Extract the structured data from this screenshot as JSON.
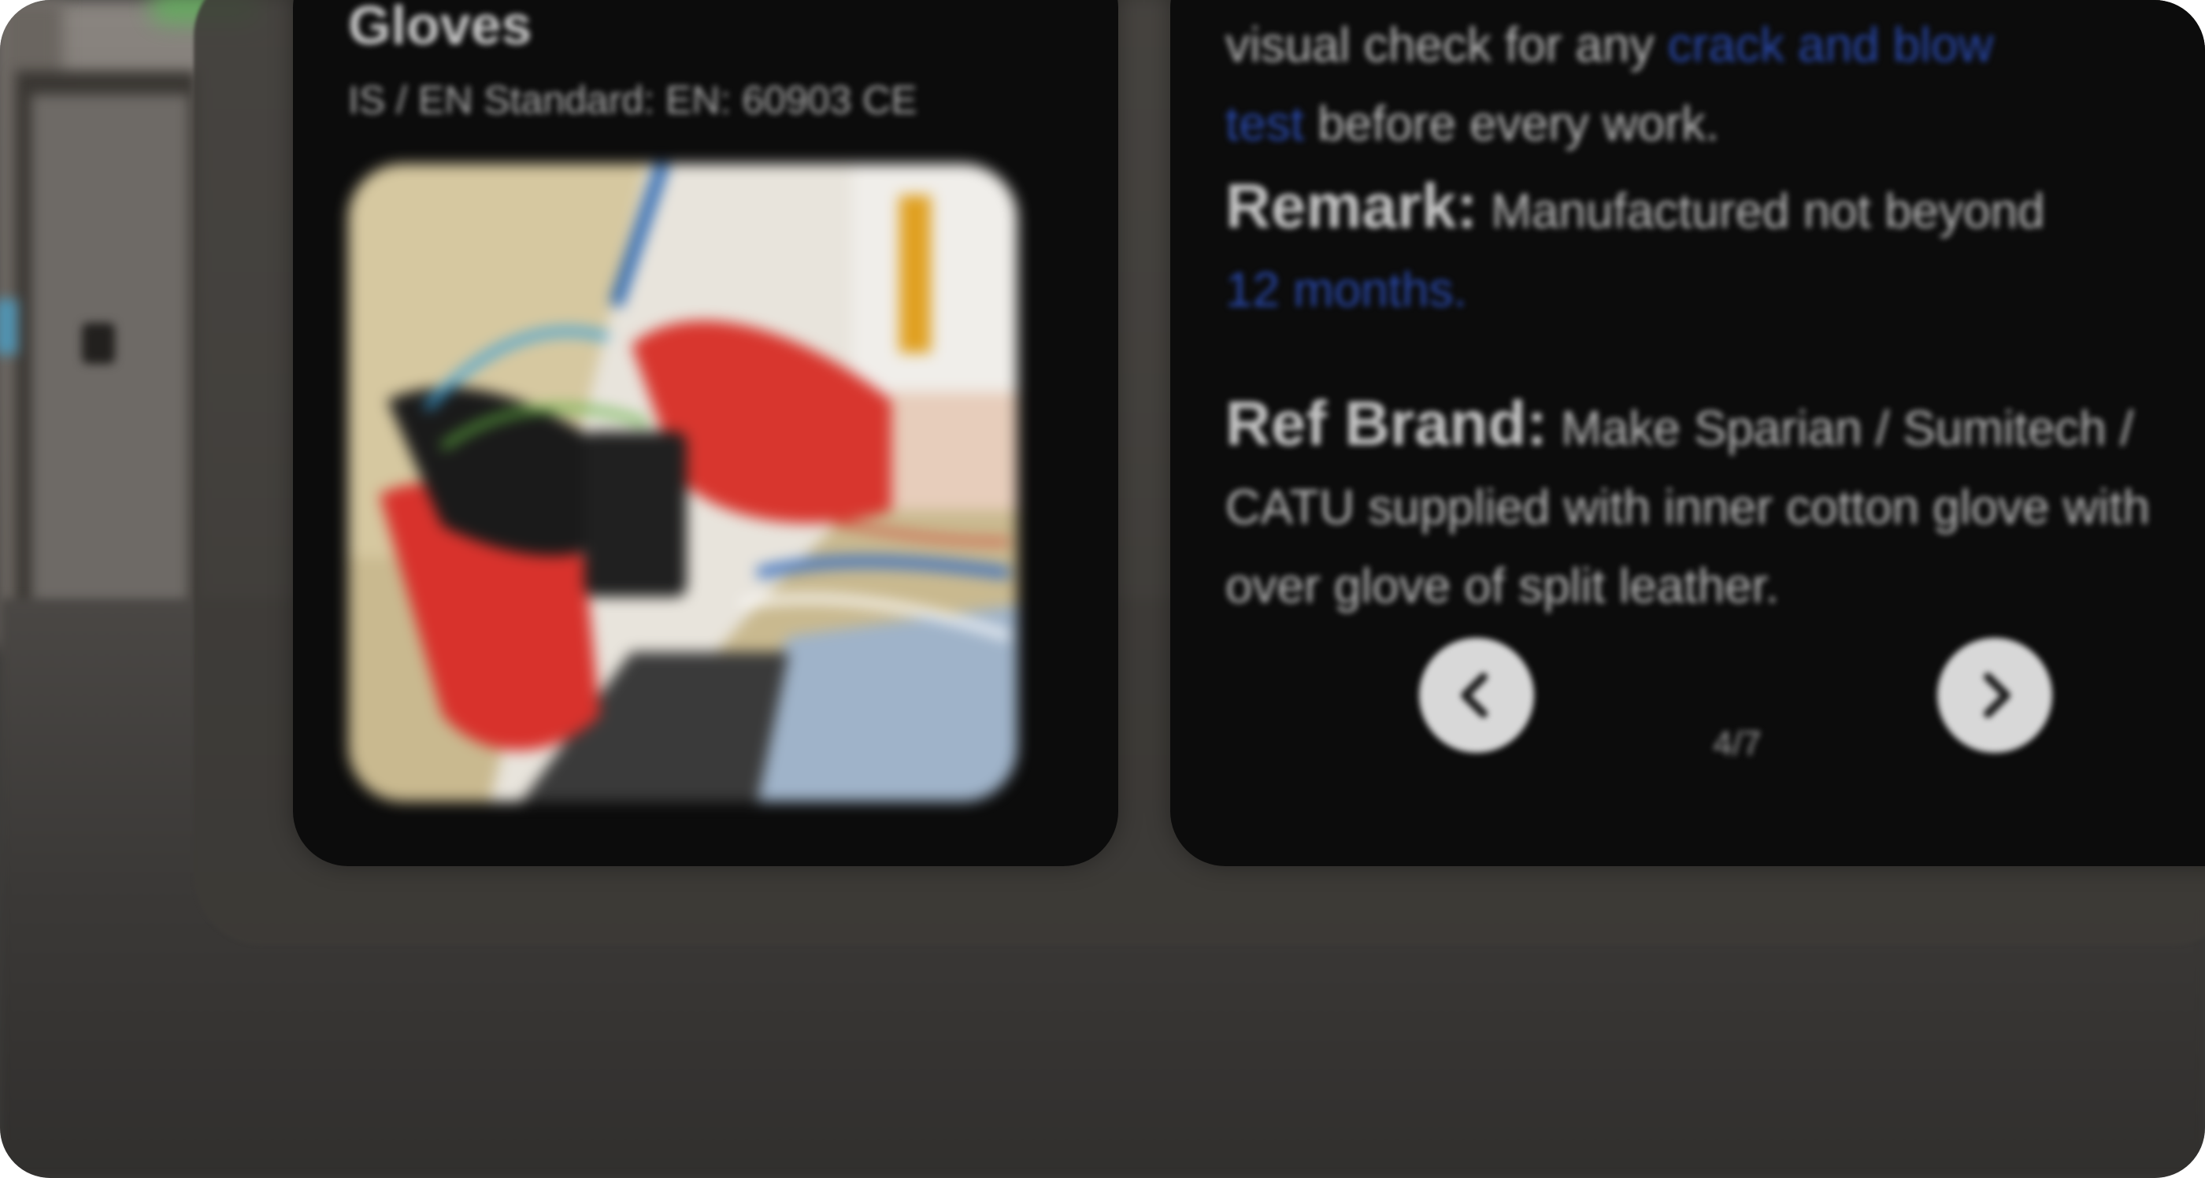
{
  "card": {
    "title": "Gloves",
    "standard": "IS / EN Standard: EN: 60903 CE"
  },
  "details": {
    "test_prefix": "visual check for any ",
    "test_highlight_1": "crack and blow",
    "test_highlight_2": "test",
    "test_suffix": " before every work.",
    "remark_label": "Remark:",
    "remark_text": " Manufactured not beyond ",
    "remark_highlight": "12 months.",
    "brand_label": "Ref Brand:",
    "brand_text": " Make Sparian / Sumitech / CATU supplied with inner cotton glove with over glove of split leather."
  },
  "pagination": {
    "prev_icon": "chevron-left-icon",
    "next_icon": "chevron-right-icon",
    "indicator": "4/7"
  },
  "colors": {
    "highlight": "#2948a8",
    "card_bg": "#0c0c0c",
    "button_bg": "#d8d8d8"
  }
}
